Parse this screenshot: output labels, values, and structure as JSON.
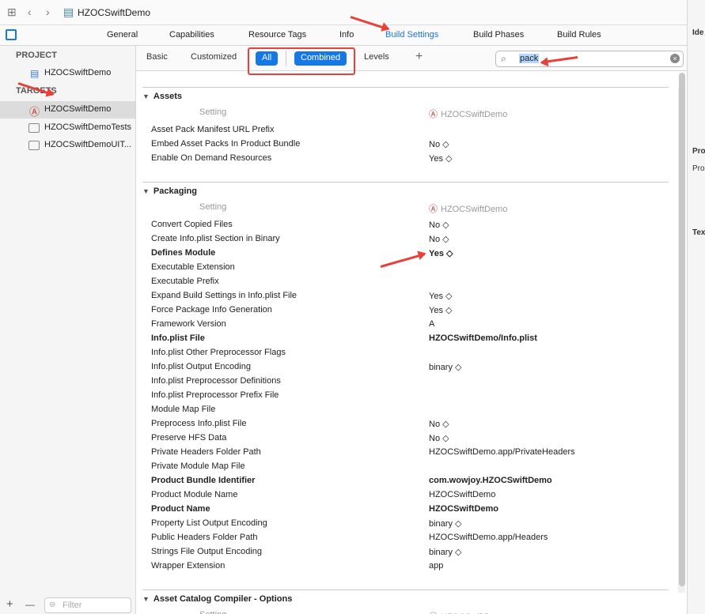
{
  "jumpbar": {
    "crumb": "HZOCSwiftDemo"
  },
  "tabs": [
    "General",
    "Capabilities",
    "Resource Tags",
    "Info",
    "Build Settings",
    "Build Phases",
    "Build Rules"
  ],
  "active_tab": "Build Settings",
  "sidebar": {
    "project_header": "PROJECT",
    "project_item": "HZOCSwiftDemo",
    "targets_header": "TARGETS",
    "targets": [
      "HZOCSwiftDemo",
      "HZOCSwiftDemoTests",
      "HZOCSwiftDemoUIT..."
    ],
    "add": "+",
    "remove": "—",
    "filter_placeholder": "Filter"
  },
  "filterbar": {
    "basic": "Basic",
    "customized": "Customized",
    "all": "All",
    "combined": "Combined",
    "levels": "Levels",
    "add": "+",
    "search": "pack"
  },
  "column_header": {
    "setting": "Setting",
    "target": "HZOCSwiftDemo"
  },
  "sections": {
    "assets": {
      "title": "Assets",
      "rows": [
        {
          "k": "Asset Pack Manifest URL Prefix",
          "v": ""
        },
        {
          "k": "Embed Asset Packs In Product Bundle",
          "v": "No ◇"
        },
        {
          "k": "Enable On Demand Resources",
          "v": "Yes ◇"
        }
      ]
    },
    "packaging": {
      "title": "Packaging",
      "rows": [
        {
          "k": "Convert Copied Files",
          "v": "No ◇",
          "b": false
        },
        {
          "k": "Create Info.plist Section in Binary",
          "v": "No ◇",
          "b": false
        },
        {
          "k": "Defines Module",
          "v": "Yes ◇",
          "b": true
        },
        {
          "k": "Executable Extension",
          "v": "",
          "b": false
        },
        {
          "k": "Executable Prefix",
          "v": "",
          "b": false
        },
        {
          "k": "Expand Build Settings in Info.plist File",
          "v": "Yes ◇",
          "b": false
        },
        {
          "k": "Force Package Info Generation",
          "v": "Yes ◇",
          "b": false
        },
        {
          "k": "Framework Version",
          "v": "A",
          "b": false
        },
        {
          "k": "Info.plist File",
          "v": "HZOCSwiftDemo/Info.plist",
          "b": true
        },
        {
          "k": "Info.plist Other Preprocessor Flags",
          "v": "",
          "b": false
        },
        {
          "k": "Info.plist Output Encoding",
          "v": "binary ◇",
          "b": false
        },
        {
          "k": "Info.plist Preprocessor Definitions",
          "v": "",
          "b": false
        },
        {
          "k": "Info.plist Preprocessor Prefix File",
          "v": "",
          "b": false
        },
        {
          "k": "Module Map File",
          "v": "",
          "b": false
        },
        {
          "k": "Preprocess Info.plist File",
          "v": "No ◇",
          "b": false
        },
        {
          "k": "Preserve HFS Data",
          "v": "No ◇",
          "b": false
        },
        {
          "k": "Private Headers Folder Path",
          "v": "HZOCSwiftDemo.app/PrivateHeaders",
          "b": false
        },
        {
          "k": "Private Module Map File",
          "v": "",
          "b": false
        },
        {
          "k": "Product Bundle Identifier",
          "v": "com.wowjoy.HZOCSwiftDemo",
          "b": true
        },
        {
          "k": "Product Module Name",
          "v": "HZOCSwiftDemo",
          "b": false
        },
        {
          "k": "Product Name",
          "v": "HZOCSwiftDemo",
          "b": true
        },
        {
          "k": "Property List Output Encoding",
          "v": "binary ◇",
          "b": false
        },
        {
          "k": "Public Headers Folder Path",
          "v": "HZOCSwiftDemo.app/Headers",
          "b": false
        },
        {
          "k": "Strings File Output Encoding",
          "v": "binary ◇",
          "b": false
        },
        {
          "k": "Wrapper Extension",
          "v": "app",
          "b": false
        }
      ]
    },
    "asset_catalog": {
      "title": "Asset Catalog Compiler - Options"
    }
  },
  "inspector": [
    "Ide",
    "Pro",
    "Pro",
    "Tex"
  ],
  "colors": {
    "accent": "#1677e6",
    "annotation": "#e8413a"
  }
}
